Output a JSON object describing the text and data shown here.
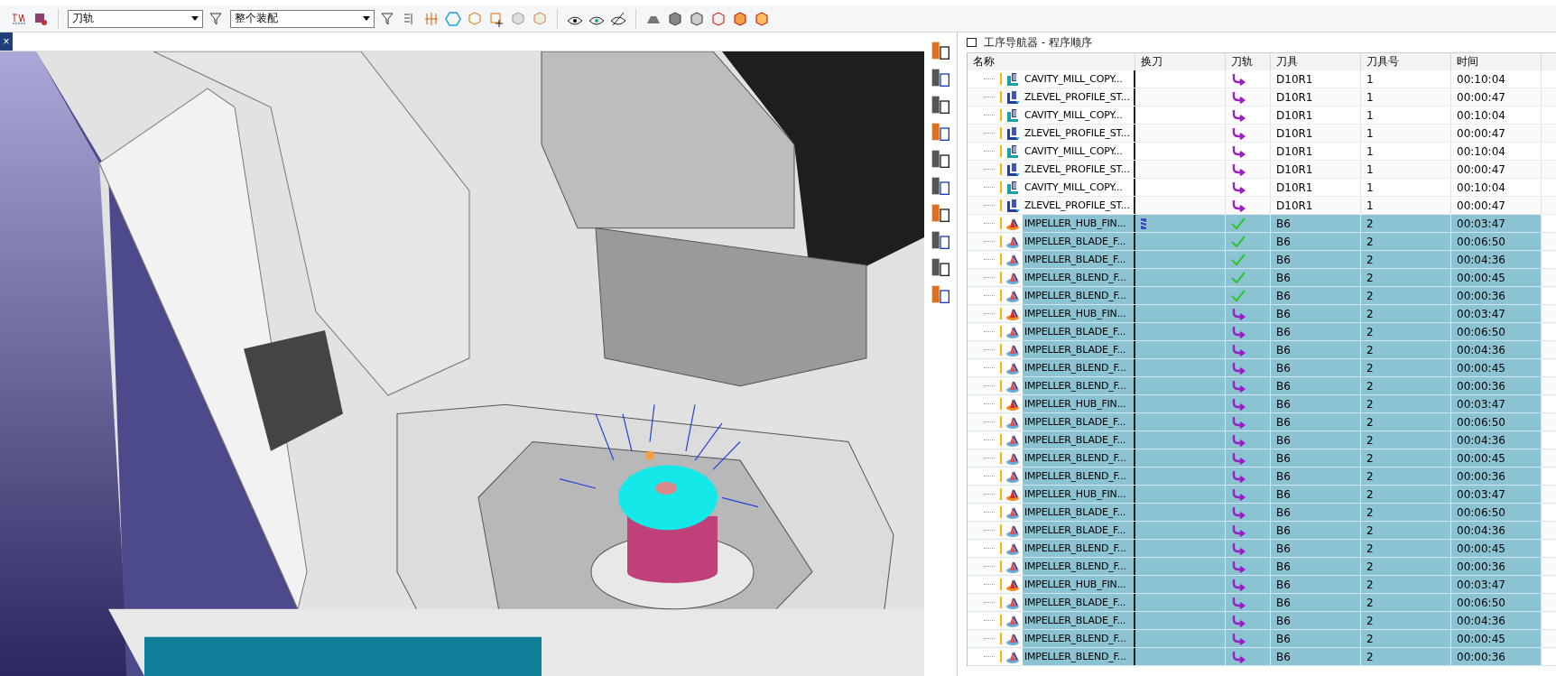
{
  "toolbar": {
    "dropdowns": [
      {
        "value": "刀轨"
      },
      {
        "value": "整个装配"
      }
    ]
  },
  "viewport": {
    "close_label": "×"
  },
  "navigator": {
    "title": "工序导航器 - 程序顺序",
    "columns": [
      "名称",
      "换刀",
      "刀轨",
      "刀具",
      "刀具号",
      "时间"
    ],
    "rows": [
      {
        "name": "CAVITY_MILL_COPY...",
        "kind": "cavity",
        "tool_change": false,
        "path_verified": false,
        "tool": "D10R1",
        "tool_number": "1",
        "time": "00:10:04",
        "selected": false
      },
      {
        "name": "ZLEVEL_PROFILE_ST...",
        "kind": "zlevel",
        "tool_change": false,
        "path_verified": false,
        "tool": "D10R1",
        "tool_number": "1",
        "time": "00:00:47",
        "selected": false
      },
      {
        "name": "CAVITY_MILL_COPY...",
        "kind": "cavity",
        "tool_change": false,
        "path_verified": false,
        "tool": "D10R1",
        "tool_number": "1",
        "time": "00:10:04",
        "selected": false
      },
      {
        "name": "ZLEVEL_PROFILE_ST...",
        "kind": "zlevel",
        "tool_change": false,
        "path_verified": false,
        "tool": "D10R1",
        "tool_number": "1",
        "time": "00:00:47",
        "selected": false
      },
      {
        "name": "CAVITY_MILL_COPY...",
        "kind": "cavity",
        "tool_change": false,
        "path_verified": false,
        "tool": "D10R1",
        "tool_number": "1",
        "time": "00:10:04",
        "selected": false
      },
      {
        "name": "ZLEVEL_PROFILE_ST...",
        "kind": "zlevel",
        "tool_change": false,
        "path_verified": false,
        "tool": "D10R1",
        "tool_number": "1",
        "time": "00:00:47",
        "selected": false
      },
      {
        "name": "CAVITY_MILL_COPY...",
        "kind": "cavity",
        "tool_change": false,
        "path_verified": false,
        "tool": "D10R1",
        "tool_number": "1",
        "time": "00:10:04",
        "selected": false
      },
      {
        "name": "ZLEVEL_PROFILE_ST...",
        "kind": "zlevel",
        "tool_change": false,
        "path_verified": false,
        "tool": "D10R1",
        "tool_number": "1",
        "time": "00:00:47",
        "selected": false
      },
      {
        "name": "IMPELLER_HUB_FIN...",
        "kind": "hub",
        "tool_change": true,
        "path_verified": true,
        "tool": "B6",
        "tool_number": "2",
        "time": "00:03:47",
        "selected": true
      },
      {
        "name": "IMPELLER_BLADE_F...",
        "kind": "blade",
        "tool_change": false,
        "path_verified": true,
        "tool": "B6",
        "tool_number": "2",
        "time": "00:06:50",
        "selected": true
      },
      {
        "name": "IMPELLER_BLADE_F...",
        "kind": "blade",
        "tool_change": false,
        "path_verified": true,
        "tool": "B6",
        "tool_number": "2",
        "time": "00:04:36",
        "selected": true
      },
      {
        "name": "IMPELLER_BLEND_F...",
        "kind": "blade",
        "tool_change": false,
        "path_verified": true,
        "tool": "B6",
        "tool_number": "2",
        "time": "00:00:45",
        "selected": true
      },
      {
        "name": "IMPELLER_BLEND_F...",
        "kind": "blade",
        "tool_change": false,
        "path_verified": true,
        "tool": "B6",
        "tool_number": "2",
        "time": "00:00:36",
        "selected": true
      },
      {
        "name": "IMPELLER_HUB_FIN...",
        "kind": "hub",
        "tool_change": false,
        "path_verified": false,
        "tool": "B6",
        "tool_number": "2",
        "time": "00:03:47",
        "selected": true
      },
      {
        "name": "IMPELLER_BLADE_F...",
        "kind": "blade",
        "tool_change": false,
        "path_verified": false,
        "tool": "B6",
        "tool_number": "2",
        "time": "00:06:50",
        "selected": true
      },
      {
        "name": "IMPELLER_BLADE_F...",
        "kind": "blade",
        "tool_change": false,
        "path_verified": false,
        "tool": "B6",
        "tool_number": "2",
        "time": "00:04:36",
        "selected": true
      },
      {
        "name": "IMPELLER_BLEND_F...",
        "kind": "blade",
        "tool_change": false,
        "path_verified": false,
        "tool": "B6",
        "tool_number": "2",
        "time": "00:00:45",
        "selected": true
      },
      {
        "name": "IMPELLER_BLEND_F...",
        "kind": "blade",
        "tool_change": false,
        "path_verified": false,
        "tool": "B6",
        "tool_number": "2",
        "time": "00:00:36",
        "selected": true
      },
      {
        "name": "IMPELLER_HUB_FIN...",
        "kind": "hub",
        "tool_change": false,
        "path_verified": false,
        "tool": "B6",
        "tool_number": "2",
        "time": "00:03:47",
        "selected": true
      },
      {
        "name": "IMPELLER_BLADE_F...",
        "kind": "blade",
        "tool_change": false,
        "path_verified": false,
        "tool": "B6",
        "tool_number": "2",
        "time": "00:06:50",
        "selected": true
      },
      {
        "name": "IMPELLER_BLADE_F...",
        "kind": "blade",
        "tool_change": false,
        "path_verified": false,
        "tool": "B6",
        "tool_number": "2",
        "time": "00:04:36",
        "selected": true
      },
      {
        "name": "IMPELLER_BLEND_F...",
        "kind": "blade",
        "tool_change": false,
        "path_verified": false,
        "tool": "B6",
        "tool_number": "2",
        "time": "00:00:45",
        "selected": true
      },
      {
        "name": "IMPELLER_BLEND_F...",
        "kind": "blade",
        "tool_change": false,
        "path_verified": false,
        "tool": "B6",
        "tool_number": "2",
        "time": "00:00:36",
        "selected": true
      },
      {
        "name": "IMPELLER_HUB_FIN...",
        "kind": "hub",
        "tool_change": false,
        "path_verified": false,
        "tool": "B6",
        "tool_number": "2",
        "time": "00:03:47",
        "selected": true
      },
      {
        "name": "IMPELLER_BLADE_F...",
        "kind": "blade",
        "tool_change": false,
        "path_verified": false,
        "tool": "B6",
        "tool_number": "2",
        "time": "00:06:50",
        "selected": true
      },
      {
        "name": "IMPELLER_BLADE_F...",
        "kind": "blade",
        "tool_change": false,
        "path_verified": false,
        "tool": "B6",
        "tool_number": "2",
        "time": "00:04:36",
        "selected": true
      },
      {
        "name": "IMPELLER_BLEND_F...",
        "kind": "blade",
        "tool_change": false,
        "path_verified": false,
        "tool": "B6",
        "tool_number": "2",
        "time": "00:00:45",
        "selected": true
      },
      {
        "name": "IMPELLER_BLEND_F...",
        "kind": "blade",
        "tool_change": false,
        "path_verified": false,
        "tool": "B6",
        "tool_number": "2",
        "time": "00:00:36",
        "selected": true
      },
      {
        "name": "IMPELLER_HUB_FIN...",
        "kind": "hub",
        "tool_change": false,
        "path_verified": false,
        "tool": "B6",
        "tool_number": "2",
        "time": "00:03:47",
        "selected": true
      },
      {
        "name": "IMPELLER_BLADE_F...",
        "kind": "blade",
        "tool_change": false,
        "path_verified": false,
        "tool": "B6",
        "tool_number": "2",
        "time": "00:06:50",
        "selected": true
      },
      {
        "name": "IMPELLER_BLADE_F...",
        "kind": "blade",
        "tool_change": false,
        "path_verified": false,
        "tool": "B6",
        "tool_number": "2",
        "time": "00:04:36",
        "selected": true
      },
      {
        "name": "IMPELLER_BLEND_F...",
        "kind": "blade",
        "tool_change": false,
        "path_verified": false,
        "tool": "B6",
        "tool_number": "2",
        "time": "00:00:45",
        "selected": true
      },
      {
        "name": "IMPELLER_BLEND_F...",
        "kind": "blade",
        "tool_change": false,
        "path_verified": false,
        "tool": "B6",
        "tool_number": "2",
        "time": "00:00:36",
        "selected": true
      }
    ]
  }
}
